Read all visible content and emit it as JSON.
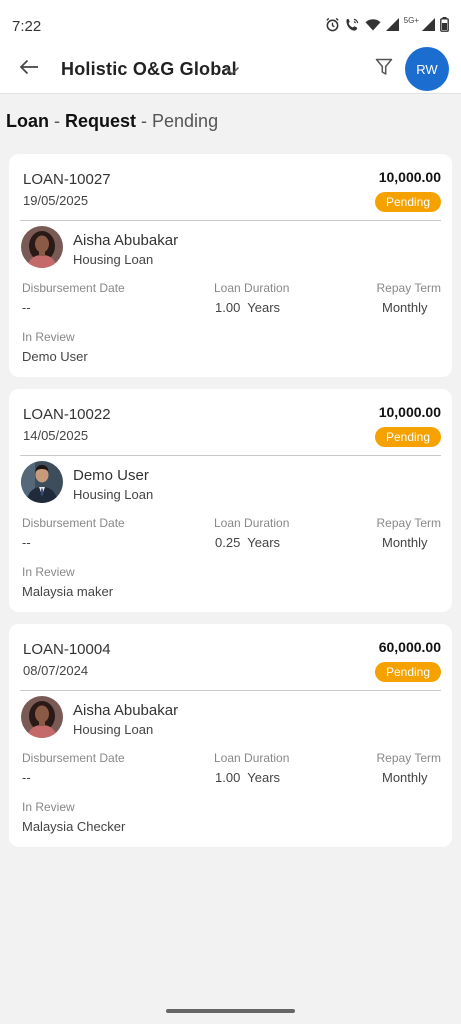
{
  "status_bar": {
    "time": "7:22",
    "network_label": "5G+",
    "icons": [
      "alarm-icon",
      "wifi-call-icon",
      "wifi-icon",
      "cell-signal-icon",
      "cell-signal-5g-icon",
      "battery-icon"
    ]
  },
  "app_bar": {
    "title": "Holistic O&G Global",
    "avatar_initials": "RW",
    "avatar_color": "#1c6dd0"
  },
  "page": {
    "heading_part1": "Loan",
    "heading_sep1": " - ",
    "heading_part2": "Request",
    "heading_sep2": " - ",
    "heading_part3": "Pending"
  },
  "field_labels": {
    "disbursement_date": "Disbursement Date",
    "loan_duration": "Loan Duration",
    "repay_term": "Repay Term",
    "in_review": "In Review"
  },
  "colors": {
    "pending_badge": "#f5a200",
    "background": "#f2f2f2",
    "card": "#ffffff"
  },
  "loans": [
    {
      "id": "LOAN-10027",
      "date": "19/05/2025",
      "amount": "10,000.00",
      "status": "Pending",
      "applicant": "Aisha Abubakar",
      "avatar": "woman-avatar",
      "loan_type": "Housing Loan",
      "disbursement_date": "--",
      "loan_duration": "1.00  Years",
      "repay_term": "Monthly",
      "in_review": "Demo User"
    },
    {
      "id": "LOAN-10022",
      "date": "14/05/2025",
      "amount": "10,000.00",
      "status": "Pending",
      "applicant": "Demo User",
      "avatar": "man-avatar",
      "loan_type": "Housing Loan",
      "disbursement_date": "--",
      "loan_duration": "0.25  Years",
      "repay_term": "Monthly",
      "in_review": "Malaysia maker"
    },
    {
      "id": "LOAN-10004",
      "date": "08/07/2024",
      "amount": "60,000.00",
      "status": "Pending",
      "applicant": "Aisha Abubakar",
      "avatar": "woman-avatar",
      "loan_type": "Housing Loan",
      "disbursement_date": "--",
      "loan_duration": "1.00  Years",
      "repay_term": "Monthly",
      "in_review": "Malaysia Checker"
    }
  ]
}
